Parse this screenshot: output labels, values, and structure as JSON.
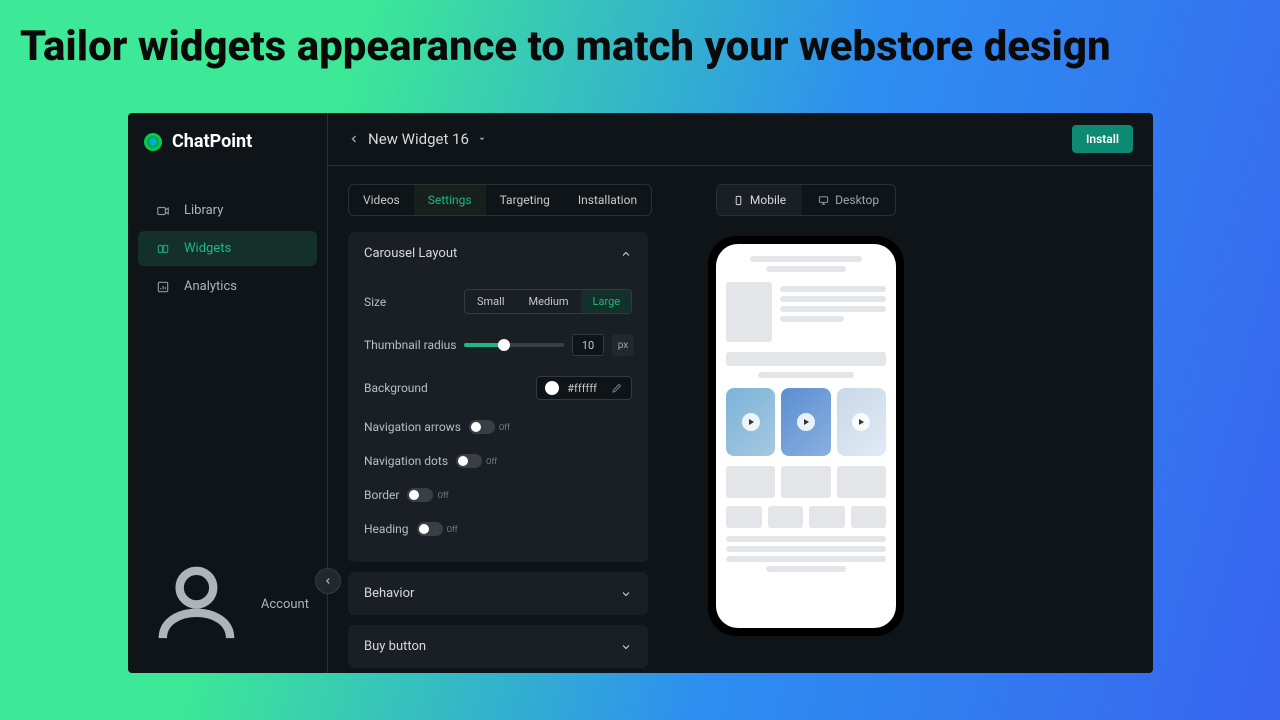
{
  "hero": "Tailor widgets appearance to match your webstore design",
  "brand": "ChatPoint",
  "sidebar": {
    "items": [
      {
        "label": "Library"
      },
      {
        "label": "Widgets"
      },
      {
        "label": "Analytics"
      }
    ],
    "account": "Account"
  },
  "header": {
    "title": "New Widget 16",
    "install_btn": "Install"
  },
  "tabs": [
    {
      "label": "Videos"
    },
    {
      "label": "Settings"
    },
    {
      "label": "Targeting"
    },
    {
      "label": "Installation"
    }
  ],
  "layout_panel": {
    "title": "Carousel Layout",
    "rows": {
      "size": {
        "label": "Size",
        "opts": [
          "Small",
          "Medium",
          "Large"
        ],
        "selected": "Large"
      },
      "radius": {
        "label": "Thumbnail radius",
        "value": "10",
        "unit": "px"
      },
      "bg": {
        "label": "Background",
        "hex": "#ffffff"
      },
      "nav_arrows": {
        "label": "Navigation arrows",
        "state": "Off"
      },
      "nav_dots": {
        "label": "Navigation dots",
        "state": "Off"
      },
      "border": {
        "label": "Border",
        "state": "Off"
      },
      "heading": {
        "label": "Heading",
        "state": "Off"
      }
    }
  },
  "panels": {
    "behavior": "Behavior",
    "buy": "Buy button"
  },
  "preview": {
    "mobile": "Mobile",
    "desktop": "Desktop"
  }
}
